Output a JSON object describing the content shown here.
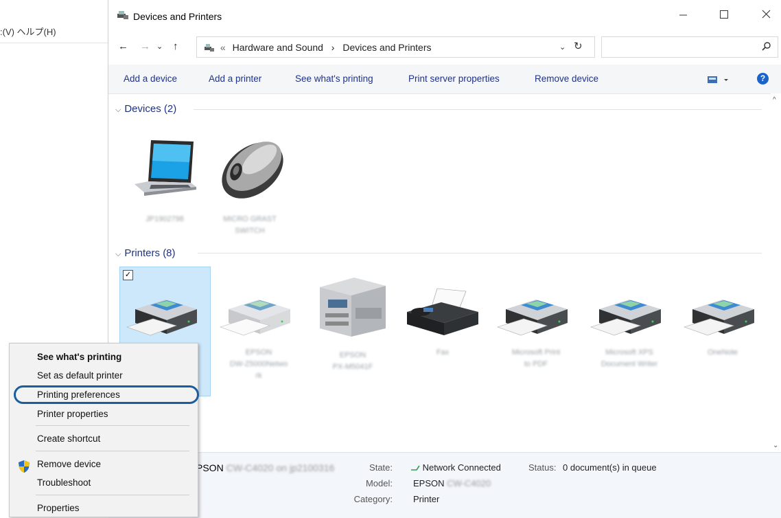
{
  "background_window": {
    "menubar_text": ":(V) ヘルプ(H)"
  },
  "window": {
    "title": "Devices and Printers",
    "controls": {
      "minimize": "—",
      "maximize": "☐",
      "close": "✕"
    }
  },
  "nav": {
    "back": "←",
    "forward": "→",
    "recent": "⌄",
    "up": "↑"
  },
  "address": {
    "overflow": "«",
    "crumbs": [
      "Hardware and Sound",
      "Devices and Printers"
    ],
    "separator": "›",
    "dropdown": "⌄",
    "refresh": "↻"
  },
  "search": {
    "placeholder": ""
  },
  "toolbar": {
    "items": [
      "Add a device",
      "Add a printer",
      "See what's printing",
      "Print server properties",
      "Remove device"
    ],
    "help": "?"
  },
  "groups": {
    "devices": {
      "title": "Devices (2)"
    },
    "printers": {
      "title": "Printers (8)"
    }
  },
  "devices": [
    {
      "icon": "laptop-icon",
      "label_lines": [
        "JP1902798"
      ]
    },
    {
      "icon": "mouse-icon",
      "label_lines": [
        "MICRO GRAST",
        "SWITCH"
      ]
    }
  ],
  "printers": [
    {
      "icon": "printer-icon",
      "label_lines": [
        ""
      ],
      "selected": true
    },
    {
      "icon": "printer-icon",
      "label_lines": [
        "EPSON",
        "DW-Z5000Netwo",
        "rk"
      ]
    },
    {
      "icon": "multifunction-printer-icon",
      "label_lines": [
        "EPSON",
        "PX-M5041F"
      ]
    },
    {
      "icon": "fax-icon",
      "label_lines": [
        "Fax"
      ]
    },
    {
      "icon": "printer-icon",
      "label_lines": [
        "Microsoft Print",
        "to PDF"
      ]
    },
    {
      "icon": "printer-icon",
      "label_lines": [
        "Microsoft XPS",
        "Document Writer"
      ]
    },
    {
      "icon": "printer-icon",
      "label_lines": [
        "OneNote"
      ]
    }
  ],
  "checkbox_mark": "✓",
  "details": {
    "name_prefix": "PSON",
    "name_blurred": "CW-C4020 on jp2100316",
    "state_label": "State:",
    "state_value": "Network Connected",
    "status_label": "Status:",
    "status_value": "0 document(s) in queue",
    "model_label": "Model:",
    "model_value": "EPSON",
    "model_blurred": "CW-C4020",
    "category_label": "Category:",
    "category_value": "Printer"
  },
  "context_menu": {
    "items": [
      "See what's printing",
      "Set as default printer",
      "Printing preferences",
      "Printer properties",
      "Create shortcut",
      "Remove device",
      "Troubleshoot",
      "Properties"
    ]
  },
  "scroll": {
    "up": "^",
    "down": "⌄"
  },
  "colors": {
    "link": "#1e3287",
    "selection": "#cde8fb",
    "highlight_ring": "#1a5d9f"
  }
}
